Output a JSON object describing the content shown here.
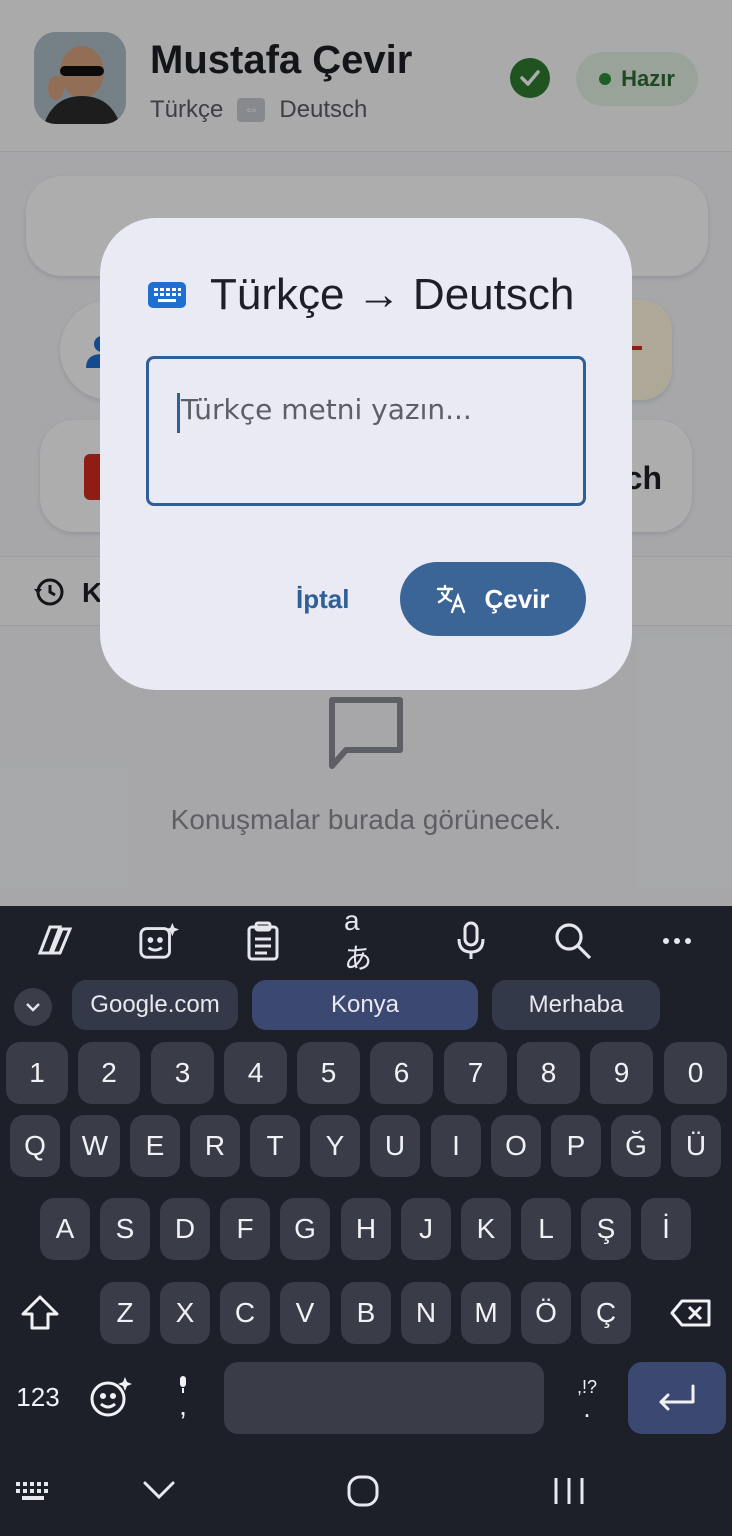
{
  "header": {
    "name": "Mustafa Çevir",
    "source_lang": "Türkçe",
    "target_lang": "Deutsch",
    "status": "Hazır"
  },
  "history": {
    "label_visible": "K"
  },
  "cards": {
    "right_second_text": "ch"
  },
  "chat": {
    "empty_text": "Konuşmalar burada görünecek."
  },
  "dialog": {
    "title": "Türkçe → Deutsch",
    "input_placeholder": "Türkçe metni yazın...",
    "cancel_label": "İptal",
    "convert_label": "Çevir"
  },
  "keyboard": {
    "suggestions": [
      "Google.com",
      "Konya",
      "Merhaba"
    ],
    "row_numbers": [
      "1",
      "2",
      "3",
      "4",
      "5",
      "6",
      "7",
      "8",
      "9",
      "0"
    ],
    "row_q": [
      "Q",
      "W",
      "E",
      "R",
      "T",
      "Y",
      "U",
      "I",
      "O",
      "P",
      "Ğ",
      "Ü"
    ],
    "row_a": [
      "A",
      "S",
      "D",
      "F",
      "G",
      "H",
      "J",
      "K",
      "L",
      "Ş",
      "İ"
    ],
    "row_z": [
      "Z",
      "X",
      "C",
      "V",
      "B",
      "N",
      "M",
      "Ö",
      "Ç"
    ],
    "symbols_label": "123",
    "comma_label": ",",
    "punct_label": ",!?",
    "period_label": "."
  },
  "colors": {
    "accent": "#3a6596",
    "status_green": "#2e7d32",
    "keyboard_bg": "#1d2029",
    "key_bg": "#3a3d47"
  }
}
